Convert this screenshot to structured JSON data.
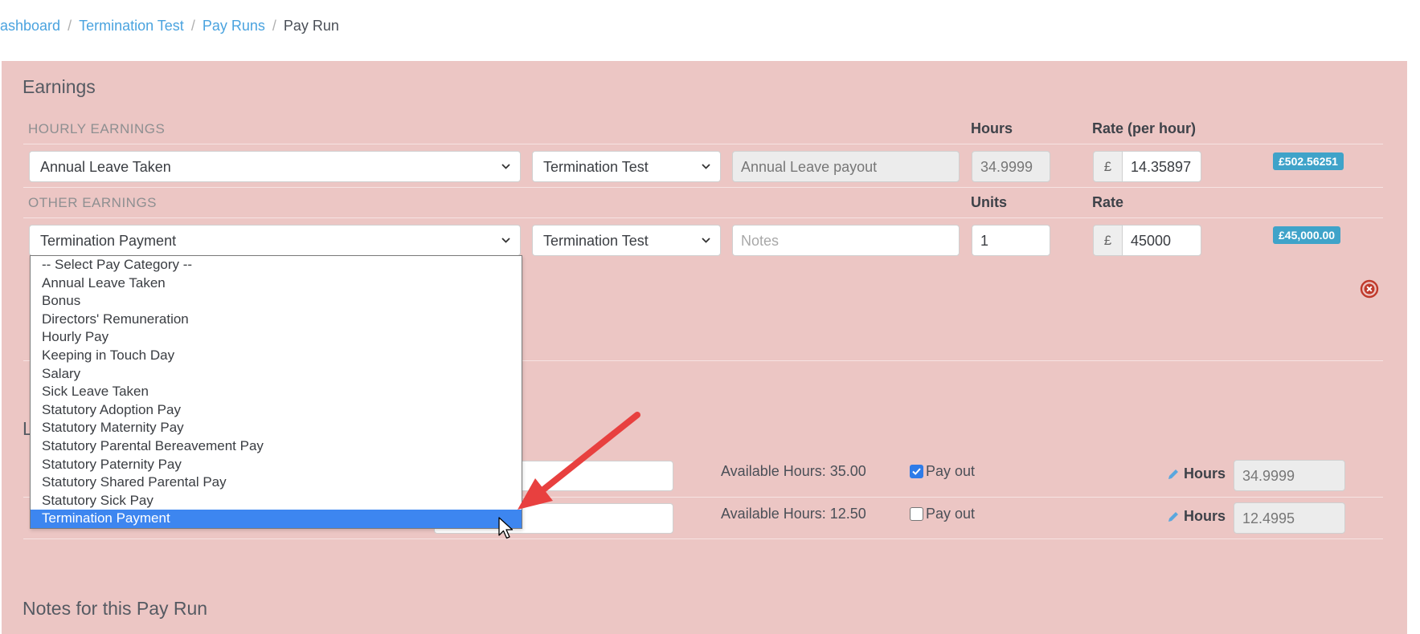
{
  "breadcrumb": {
    "items": [
      "ashboard",
      "Termination Test",
      "Pay Runs"
    ],
    "current": "Pay Run"
  },
  "earnings": {
    "title": "Earnings",
    "hourly": {
      "section_label": "HOURLY EARNINGS",
      "hours_header": "Hours",
      "rate_header": "Rate (per hour)",
      "row": {
        "category": "Annual Leave Taken",
        "location": "Termination Test",
        "notes": "Annual Leave payout",
        "hours": "34.9999",
        "currency": "£",
        "rate": "14.35897",
        "total": "£502.56251"
      }
    },
    "other": {
      "section_label": "OTHER EARNINGS",
      "units_header": "Units",
      "rate_header": "Rate",
      "row": {
        "category": "Termination Payment",
        "location": "Termination Test",
        "notes_placeholder": "Notes",
        "units": "1",
        "currency": "£",
        "rate": "45000",
        "total": "£45,000.00"
      }
    }
  },
  "dropdown": {
    "options": [
      "-- Select Pay Category --",
      "Annual Leave Taken",
      "Bonus",
      "Directors' Remuneration",
      "Hourly Pay",
      "Keeping in Touch Day",
      "Salary",
      "Sick Leave Taken",
      "Statutory Adoption Pay",
      "Statutory Maternity Pay",
      "Statutory Parental Bereavement Pay",
      "Statutory Paternity Pay",
      "Statutory Shared Parental Pay",
      "Statutory Sick Pay",
      "Termination Payment"
    ],
    "selected_index": 14
  },
  "leave": {
    "title_partial": "L",
    "rows": [
      {
        "available": "Available Hours: 35.00",
        "pay_out_label": "Pay out",
        "pay_out": true,
        "hours_label": "Hours",
        "hours": "34.9999"
      },
      {
        "available": "Available Hours: 12.50",
        "pay_out_label": "Pay out",
        "pay_out": false,
        "hours_label": "Hours",
        "hours": "12.4995"
      }
    ]
  },
  "notes_section": {
    "title": "Notes for this Pay Run"
  },
  "colors": {
    "panel_bg": "#ecc6c4",
    "link": "#4aa3df",
    "badge": "#3fa3c9",
    "selection": "#3d86f0",
    "arrow": "#e8403f",
    "remove_icon": "#c0392b"
  },
  "icons": [
    "chevron-down-icon",
    "remove-circle-icon",
    "pencil-icon",
    "mouse-cursor-icon",
    "annotation-arrow-icon",
    "checkbox-checked-icon"
  ]
}
